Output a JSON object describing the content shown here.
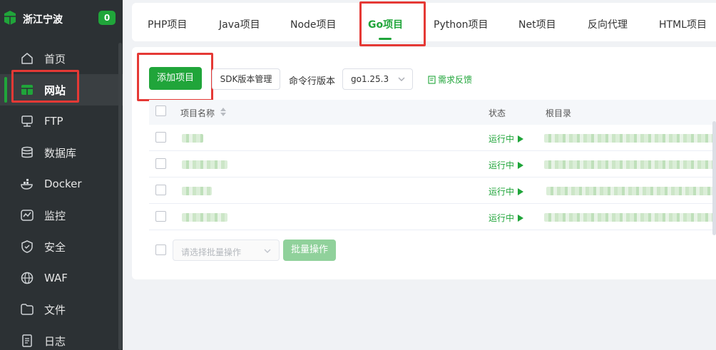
{
  "brand": {
    "name": "浙江宁波",
    "badge": "0"
  },
  "sidebar": {
    "items": [
      {
        "label": "首页",
        "icon": "home-icon"
      },
      {
        "label": "网站",
        "icon": "website-icon",
        "active": true
      },
      {
        "label": "FTP",
        "icon": "ftp-icon"
      },
      {
        "label": "数据库",
        "icon": "database-icon"
      },
      {
        "label": "Docker",
        "icon": "docker-icon"
      },
      {
        "label": "监控",
        "icon": "monitor-icon"
      },
      {
        "label": "安全",
        "icon": "shield-icon"
      },
      {
        "label": "WAF",
        "icon": "waf-icon"
      },
      {
        "label": "文件",
        "icon": "folder-icon"
      },
      {
        "label": "日志",
        "icon": "log-icon"
      }
    ]
  },
  "tabs": [
    "PHP项目",
    "Java项目",
    "Node项目",
    "Go项目",
    "Python项目",
    "Net项目",
    "反向代理",
    "HTML项目"
  ],
  "active_tab": "Go项目",
  "toolbar": {
    "add_label": "添加项目",
    "sdk_label": "SDK版本管理",
    "cmd_label": "命令行版本",
    "version": "go1.25.3",
    "feedback": "需求反馈"
  },
  "table": {
    "headers": {
      "name": "项目名称",
      "status": "状态",
      "root": "根目录"
    },
    "rows": [
      {
        "status": "运行中"
      },
      {
        "status": "运行中"
      },
      {
        "status": "运行中"
      },
      {
        "status": "运行中"
      }
    ]
  },
  "batch": {
    "placeholder": "请选择批量操作",
    "button": "批量操作"
  },
  "colors": {
    "accent": "#20a53a",
    "sidebar_bg": "#2c3134",
    "highlight": "#e53935"
  }
}
